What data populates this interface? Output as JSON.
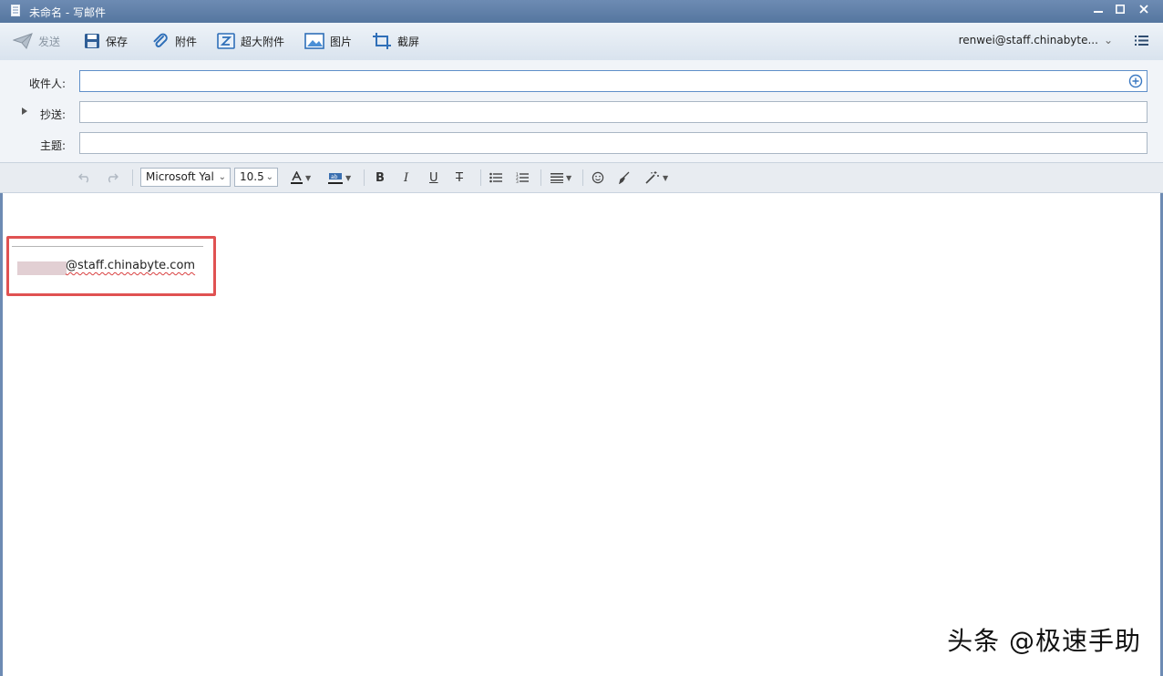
{
  "window": {
    "title": "未命名 - 写邮件"
  },
  "toolbar": {
    "send": "发送",
    "save": "保存",
    "attach": "附件",
    "big_attach": "超大附件",
    "image": "图片",
    "screenshot": "截屏",
    "account": "renwei@staff.chinabyte..."
  },
  "fields": {
    "to_label": "收件人:",
    "cc_label": "抄送:",
    "subject_label": "主题:",
    "to_value": "",
    "cc_value": "",
    "subject_value": ""
  },
  "format": {
    "font": "Microsoft Yal",
    "size": "10.5"
  },
  "editor": {
    "signature_text": "@staff.chinabyte.com"
  },
  "watermark": "头条 @极速手助",
  "colors": {
    "titlebar": "#5f80aa",
    "highlight": "#e05252",
    "accent": "#3a78c2"
  }
}
